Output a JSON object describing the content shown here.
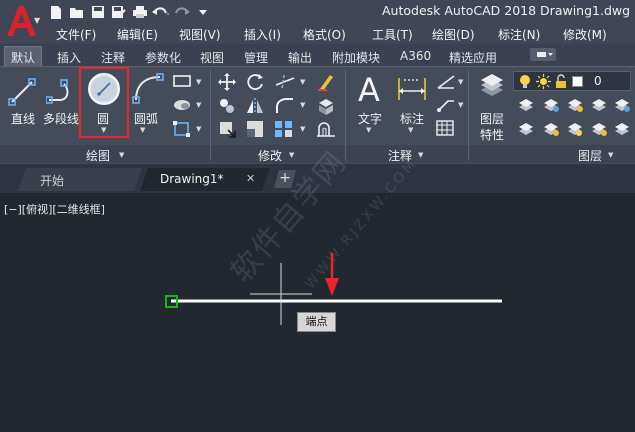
{
  "window": {
    "title": "Autodesk AutoCAD 2018    Drawing1.dwg"
  },
  "app_menu": {
    "icon": "autocad-a-logo"
  },
  "quick_access": [
    {
      "name": "new-icon"
    },
    {
      "name": "open-icon"
    },
    {
      "name": "save-icon"
    },
    {
      "name": "save-as-icon"
    },
    {
      "name": "print-icon"
    },
    {
      "name": "undo-icon"
    },
    {
      "name": "redo-icon"
    },
    {
      "name": "qat-dropdown-icon"
    }
  ],
  "menubar": {
    "items": [
      "文件(F)",
      "编辑(E)",
      "视图(V)",
      "插入(I)",
      "格式(O)",
      "工具(T)",
      "绘图(D)",
      "标注(N)",
      "修改(M)"
    ]
  },
  "ribbon_tabs": {
    "items": [
      "默认",
      "插入",
      "注释",
      "参数化",
      "视图",
      "管理",
      "输出",
      "附加模块",
      "A360",
      "精选应用"
    ],
    "active": "默认"
  },
  "draw_panel": {
    "line_label": "直线",
    "polyline_label": "多段线",
    "circle_label": "圆",
    "arc_label": "圆弧",
    "title": "绘图"
  },
  "modify_panel": {
    "title": "修改"
  },
  "annotation_panel": {
    "text_label": "文字",
    "dimension_label": "标注",
    "title": "注释"
  },
  "layers_panel": {
    "properties_label_1": "图层",
    "properties_label_2": "特性",
    "current_layer": "0",
    "title": "图层"
  },
  "doc_tabs": {
    "start_label": "开始",
    "drawing_label": "Drawing1*",
    "close_glyph": "✕",
    "plus_glyph": "+"
  },
  "viewport": {
    "label": "[−][俯视][二维线框]",
    "watermark": "软件自学网",
    "watermark_url": "WWW.RJZXW.COM",
    "snap_tooltip": "端点"
  },
  "colors": {
    "accent_red": "#e8262c",
    "snap_green": "#18b418",
    "canvas_bg": "#212830"
  }
}
